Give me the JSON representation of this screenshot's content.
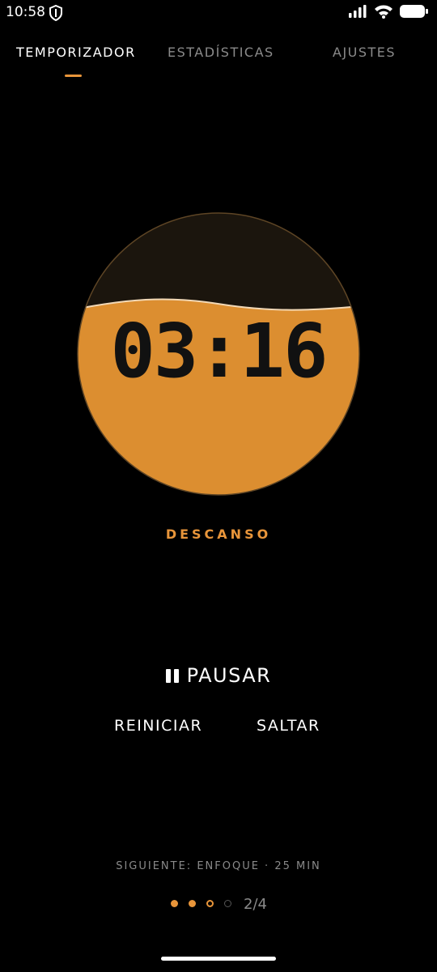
{
  "status_bar": {
    "time": "10:58",
    "icons": [
      "shield-icon",
      "signal-icon",
      "wifi-icon",
      "battery-icon"
    ]
  },
  "tabs": [
    {
      "label": "TEMPORIZADOR",
      "active": true
    },
    {
      "label": "ESTADÍSTICAS",
      "active": false
    },
    {
      "label": "AJUSTES",
      "active": false
    }
  ],
  "timer": {
    "time": "03:16",
    "mode": "DESCANSO",
    "fill_fraction": 0.67
  },
  "controls": {
    "pause_label": "PAUSAR",
    "reset_label": "REINICIAR",
    "skip_label": "SALTAR"
  },
  "next_session": "SIGUIENTE: ENFOQUE · 25 MIN",
  "progress": {
    "count_text": "2/4",
    "completed": 2,
    "current": 3,
    "total": 4
  },
  "colors": {
    "accent": "#e8953a",
    "fill": "#dc8e30",
    "dial_empty": "#1b150d",
    "background": "#000000"
  }
}
